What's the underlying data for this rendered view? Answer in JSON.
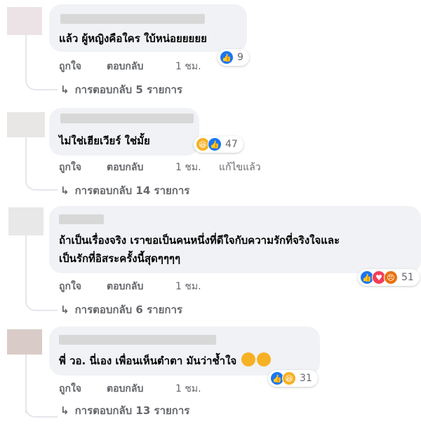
{
  "comments": [
    {
      "text": "แล้ว ผู้หญิงคือใคร ใบ้หน่อยยยยย",
      "actions": {
        "like": "ถูกใจ",
        "reply": "ตอบกลับ",
        "time": "1 ชม."
      },
      "reactions": {
        "types": [
          "like"
        ],
        "count": "9"
      },
      "replies_label": "การตอบกลับ 5 รายการ"
    },
    {
      "text": "ไม่ใช่เฮียเวียร์ ใช่มั้ย",
      "actions": {
        "like": "ถูกใจ",
        "reply": "ตอบกลับ",
        "time": "1 ชม.",
        "edited": "แก้ไขแล้ว"
      },
      "reactions": {
        "types": [
          "haha",
          "like"
        ],
        "count": "47"
      },
      "replies_label": "การตอบกลับ 14 รายการ"
    },
    {
      "text": "ถ้าเป็นเรื่องจริง เราขอเป็นคนหนึ่งที่ดีใจกับความรักที่จริงใจและ\nเป็นรักที่อิสระครั้งนี้สุดๆๆๆๆ",
      "actions": {
        "like": "ถูกใจ",
        "reply": "ตอบกลับ",
        "time": "1 ชม."
      },
      "reactions": {
        "types": [
          "like",
          "love",
          "angry"
        ],
        "count": "51"
      },
      "replies_label": "การตอบกลับ 6 รายการ"
    },
    {
      "text": "พี่ วอ. นี่เอง เพื่อนเห็นตำตา มันว่าช้ำใจ",
      "actions": {
        "like": "ถูกใจ",
        "reply": "ตอบกลับ",
        "time": "1 ชม."
      },
      "reactions": {
        "types": [
          "like",
          "haha"
        ],
        "count": "31"
      },
      "replies_label": "การตอบกลับ 13 รายการ"
    }
  ],
  "icons": {
    "reply_arrow": "↳",
    "like": "like-icon",
    "haha": "haha-icon",
    "love": "love-icon",
    "angry": "angry-icon"
  },
  "colors": {
    "bubble": "#f0f2f5",
    "secondary_text": "#65676b",
    "like_blue": "#1877f2",
    "haha_yellow": "#f7b125",
    "love_red": "#f33e58",
    "angry_orange": "#e9710f"
  }
}
